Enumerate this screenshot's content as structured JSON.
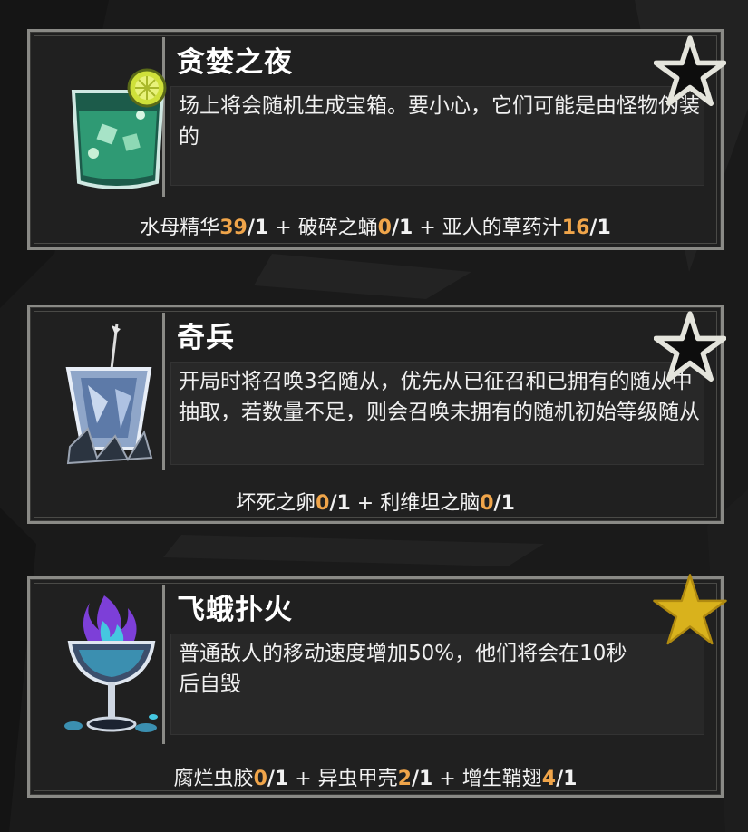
{
  "cards": [
    {
      "title": "贪婪之夜",
      "description": "场上将会随机生成宝箱。要小心，它们可能是由怪物伪装的",
      "icon": "green-cocktail-glass-icon",
      "star": "outline",
      "ingredients": [
        {
          "name": "水母精华",
          "have": "39",
          "need": "/1"
        },
        {
          "name": "破碎之蛹",
          "have": "0",
          "need": "/1"
        },
        {
          "name": "亚人的草药汁",
          "have": "16",
          "need": "/1"
        }
      ]
    },
    {
      "title": "奇兵",
      "description": "开局时将召唤3名随从，优先从已征召和已拥有的随从中抽取，若数量不足，则会召唤未拥有的随机初始等级随从",
      "icon": "ice-crystal-glass-icon",
      "star": "outline",
      "ingredients": [
        {
          "name": "坏死之卵",
          "have": "0",
          "need": "/1"
        },
        {
          "name": "利维坦之脑",
          "have": "0",
          "need": "/1"
        }
      ]
    },
    {
      "title": "飞蛾扑火",
      "description": "普通敌人的移动速度增加50%，他们将会在10秒后自毁",
      "icon": "purple-flame-goblet-icon",
      "star": "filled",
      "ingredients": [
        {
          "name": "腐烂虫胶",
          "have": "0",
          "need": "/1"
        },
        {
          "name": "异虫甲壳",
          "have": "2",
          "need": "/1"
        },
        {
          "name": "增生鞘翅",
          "have": "4",
          "need": "/1"
        }
      ]
    }
  ],
  "separator": "+",
  "colors": {
    "have": "#f0a54a",
    "star_filled": "#d9b21c",
    "border": "#8a8a86"
  }
}
